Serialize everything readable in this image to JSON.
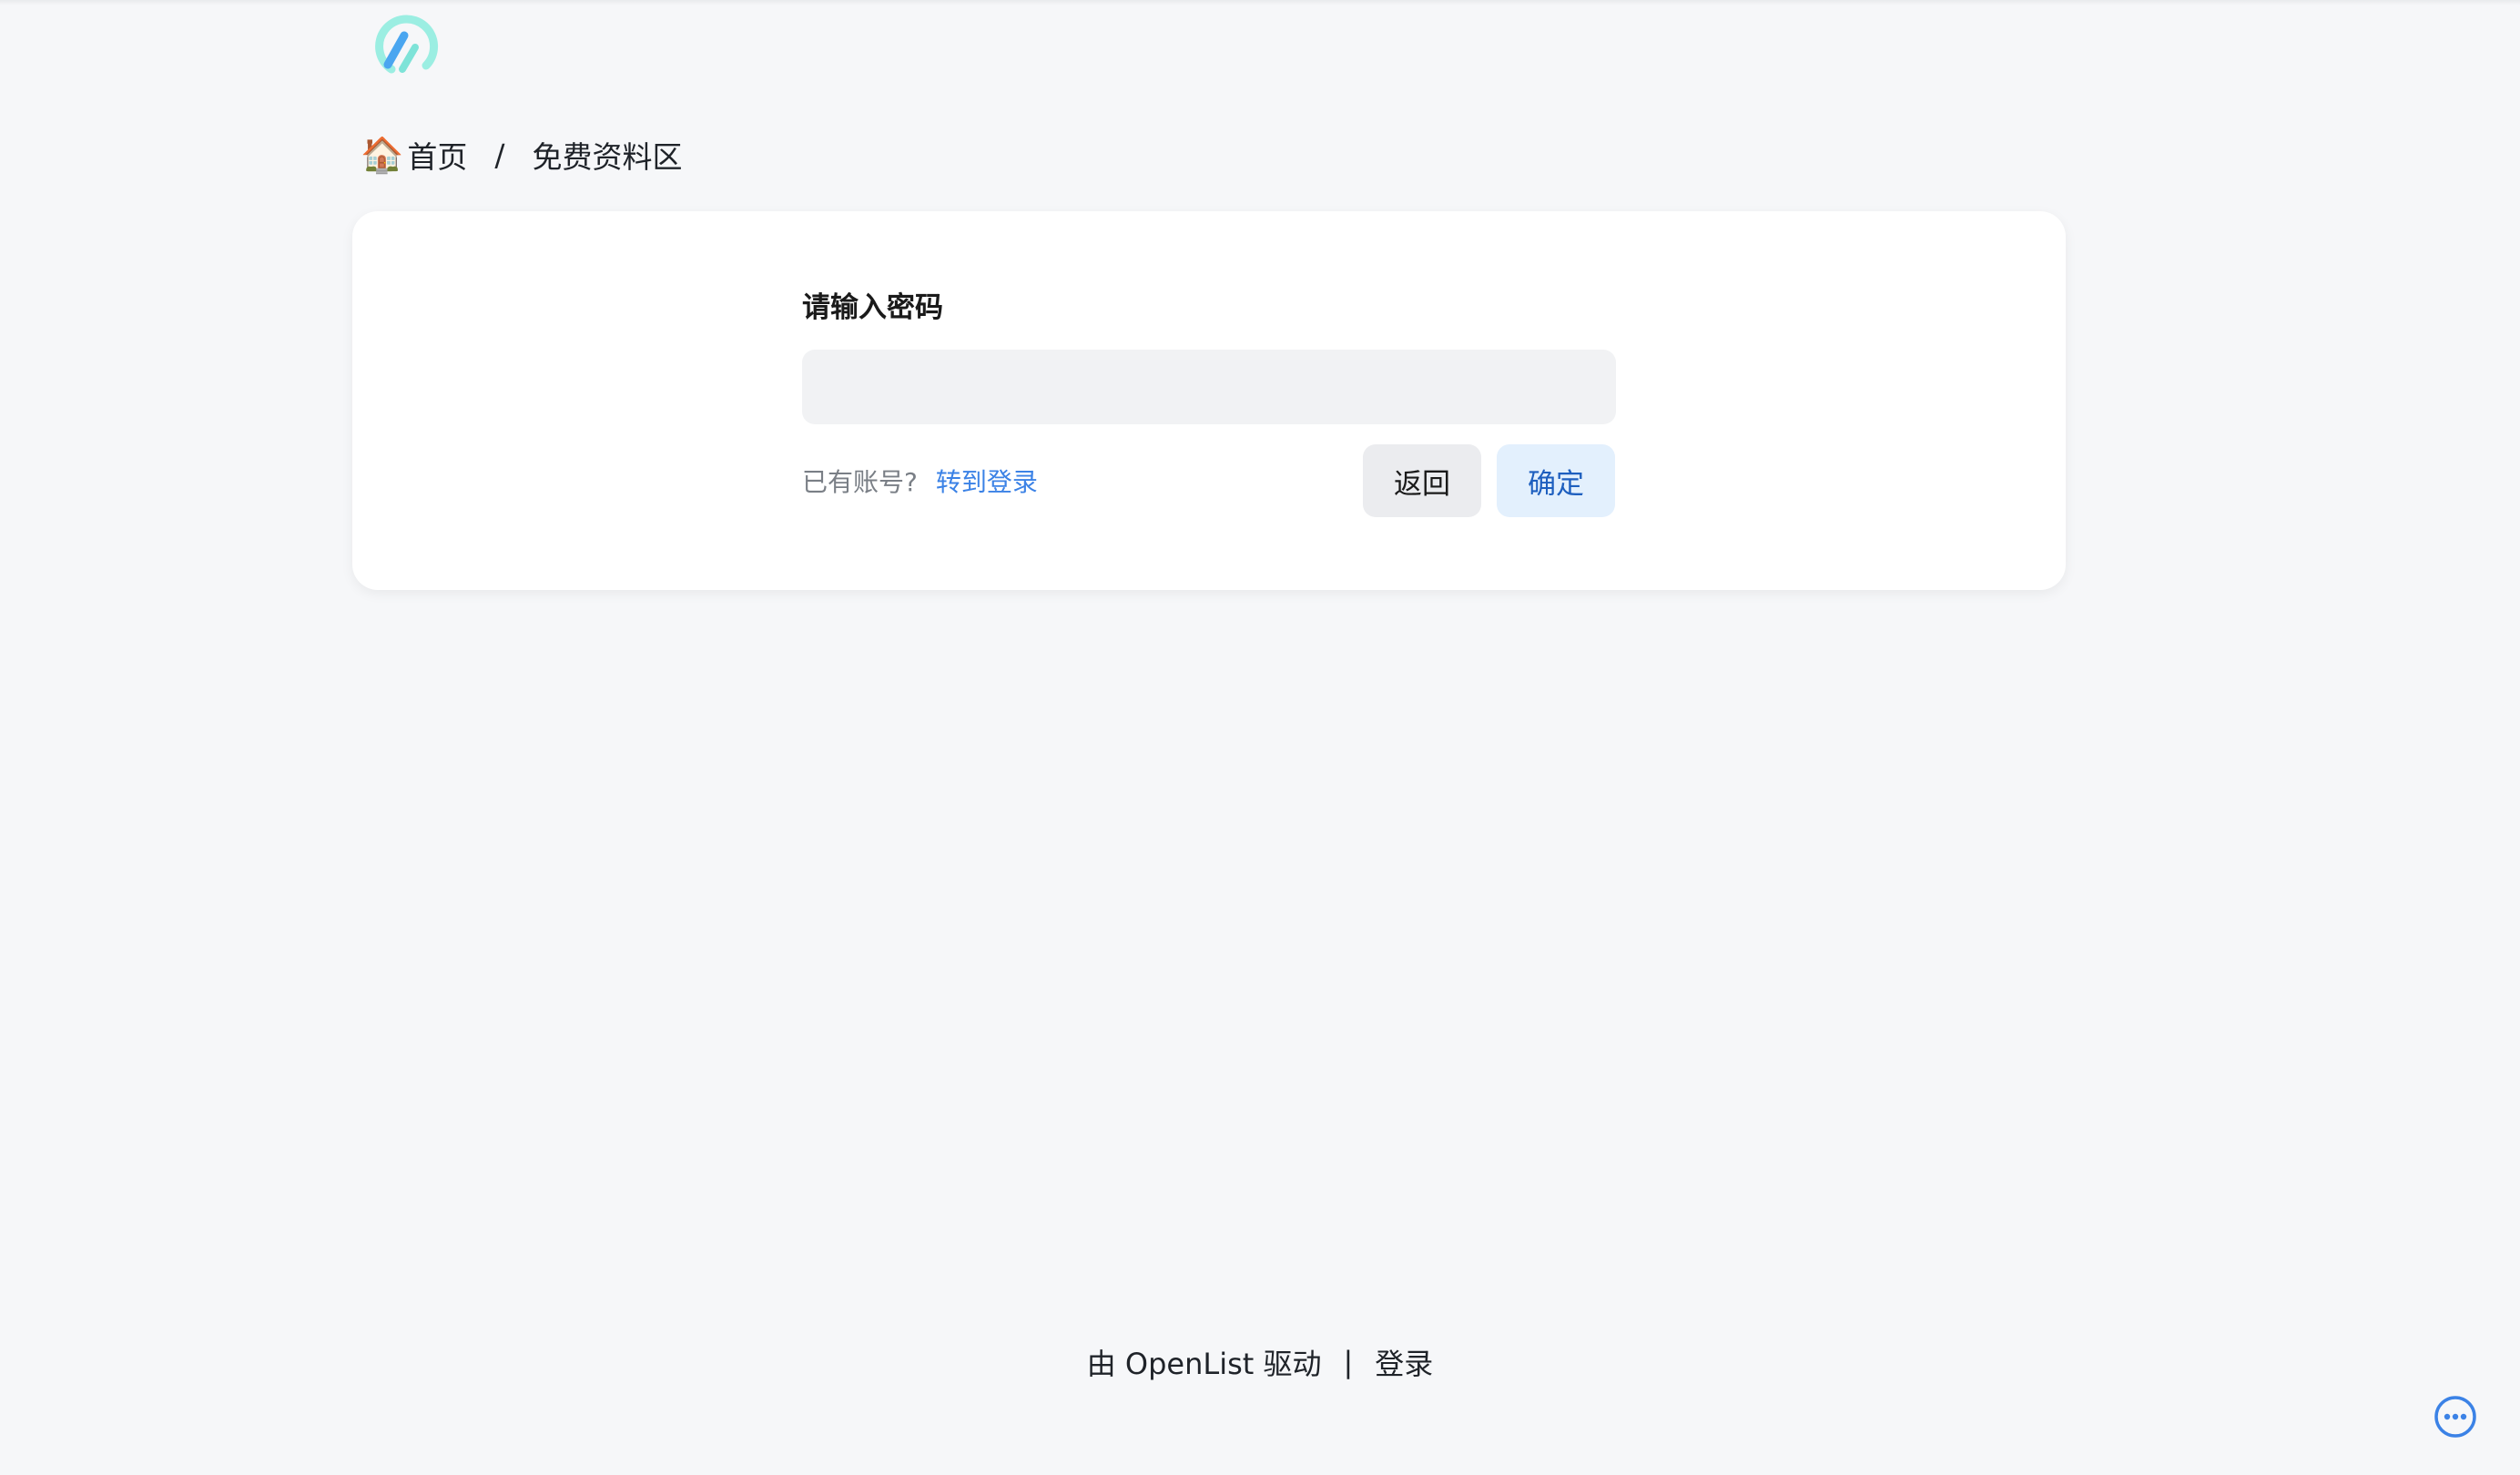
{
  "breadcrumb": {
    "home_icon": "🏠",
    "home_label": "首页",
    "separator": "/",
    "current": "免费资料区"
  },
  "password_form": {
    "title": "请输入密码",
    "input_value": "",
    "hint_text": "已有账号?",
    "login_link": "转到登录",
    "back_button": "返回",
    "confirm_button": "确定"
  },
  "footer": {
    "powered_by": "由 OpenList 驱动",
    "separator": "|",
    "login_link": "登录"
  },
  "icons": {
    "logo": "openlist-logo-icon",
    "home": "house-icon",
    "more": "more-horizontal-circle-icon"
  },
  "colors": {
    "accent": "#3b82e6",
    "logo_teal": "#7ee3d8",
    "logo_blue": "#4aa6f0",
    "confirm_bg": "#e3f0fd",
    "background": "#f6f7f9"
  }
}
